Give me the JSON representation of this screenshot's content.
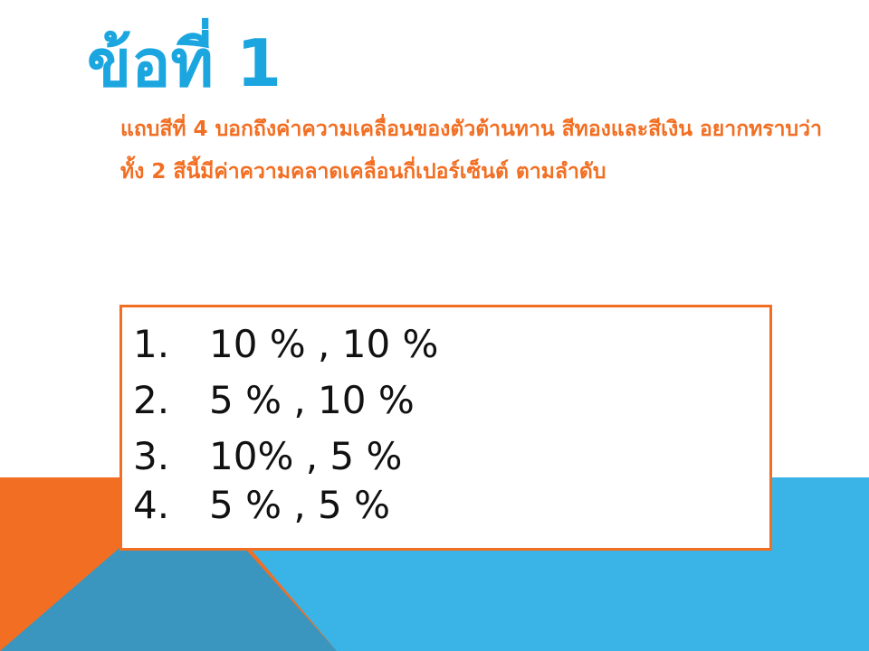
{
  "colors": {
    "title": "#1BA6E0",
    "question": "#F26E22",
    "orange_shape": "#F26E22",
    "light_blue_shape": "#3AB4E6",
    "dark_blue_shape": "#3A96BE",
    "box_border": "#F26E22"
  },
  "slide": {
    "title": "ข้อที่ 1",
    "question": "แถบสีที่ 4 บอกถึงค่าความเคลื่อนของตัวต้านทาน สีทองและสีเงิน อยากทราบว่า ทั้ง 2 สีนี้มีค่าความคลาดเคลื่อนกี่เปอร์เซ็นต์ ตามลำดับ",
    "options": [
      {
        "number": "1.",
        "text": "10 % , 10 %"
      },
      {
        "number": "2.",
        "text": "5 % , 10 %"
      },
      {
        "number": "3.",
        "text": "10% , 5 %"
      },
      {
        "number": "4.",
        "text": "5 % , 5 %"
      }
    ]
  }
}
